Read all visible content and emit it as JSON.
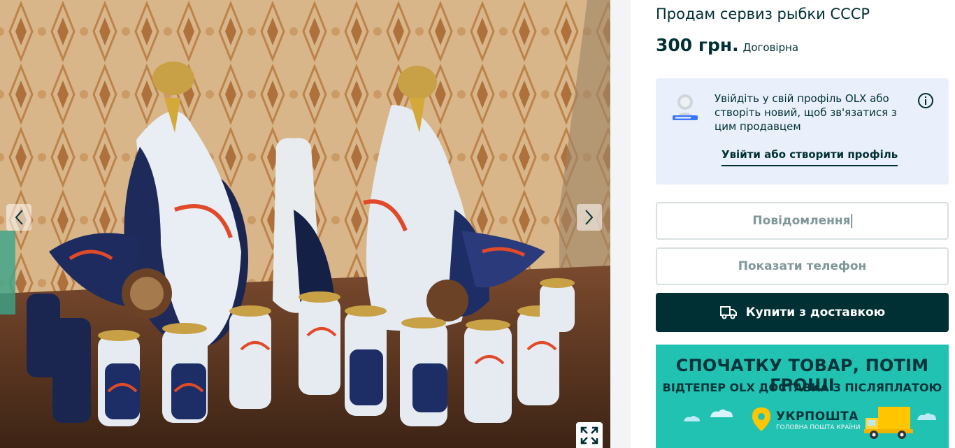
{
  "listing": {
    "title": "Продам сервиз рыбки СССР",
    "price": "300 грн.",
    "negotiable": "Договірна"
  },
  "gallery": {
    "prev_icon": "chevron-left-icon",
    "next_icon": "chevron-right-icon",
    "expand_icon": "expand-icon"
  },
  "login_prompt": {
    "text": "Увійдіть у свій профіль OLX або створіть новий, щоб зв'язатися з цим продавцем",
    "link": "Увійти або створити профіль",
    "avatar_icon": "user-avatar-icon",
    "info_icon": "info-icon"
  },
  "actions": {
    "message_placeholder": "Повідомлення",
    "show_phone": "Показати телефон",
    "buy_delivery": "Купити з доставкою",
    "buy_icon": "delivery-truck-icon"
  },
  "promo": {
    "headline": "СПОЧАТКУ ТОВАР, ПОТІМ ГРОШІ",
    "subline": "ВІДТЕПЕР OLX ДОСТАВКА З ПІСЛЯПЛАТОЮ",
    "brand": "УКРПОШТА",
    "brand_slogan": "ГОЛОВНА ПОШТА КРАЇНИ"
  },
  "colors": {
    "brand_dark": "#002f34",
    "login_card_bg": "#e9f0fb",
    "promo_bg": "#22c2b2",
    "promo_yellow": "#ffc600"
  }
}
